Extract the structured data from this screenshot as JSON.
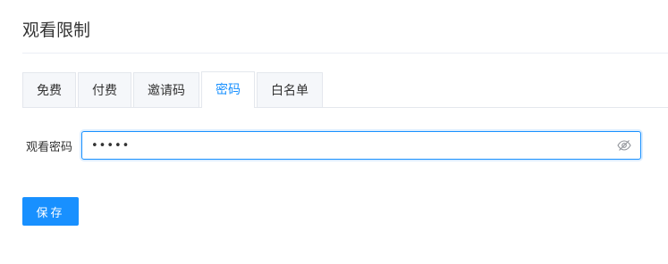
{
  "page": {
    "title": "观看限制"
  },
  "tabs": [
    {
      "label": "免费",
      "active": false
    },
    {
      "label": "付费",
      "active": false
    },
    {
      "label": "邀请码",
      "active": false
    },
    {
      "label": "密码",
      "active": true
    },
    {
      "label": "白名单",
      "active": false
    }
  ],
  "form": {
    "password_label": "观看密码",
    "password_value": "•••••",
    "visibility_icon": "eye-off-icon"
  },
  "actions": {
    "save_label": "保存"
  },
  "colors": {
    "accent": "#1890ff",
    "tab_inactive_bg": "#f5f7fa",
    "border": "#e4e7ed"
  }
}
